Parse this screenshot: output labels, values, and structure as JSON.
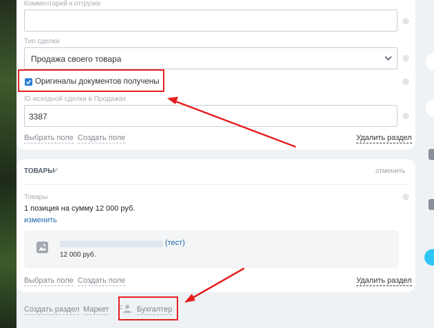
{
  "shipment": {
    "comment_label": "Комментарий к отгрузке",
    "comment_value": ""
  },
  "deal_type": {
    "label": "Тип сделки",
    "value": "Продажа своего товара"
  },
  "originals": {
    "label": "Оригиналы документов получены",
    "checked": true
  },
  "source_deal": {
    "label": "ID исходной сделки в Продажах",
    "value": "3387"
  },
  "section1_footer": {
    "choose_field": "Выбрать поле",
    "create_field": "Создать поле",
    "delete_section": "Удалить раздел"
  },
  "products": {
    "title": "ТОВАРЫ",
    "cancel": "отменить",
    "field_label": "Товары",
    "summary": "1 позиция на сумму 12 000 руб.",
    "change": "изменить",
    "item_suffix": "(тест)",
    "item_price": "12 000 руб."
  },
  "section2_footer": {
    "choose_field": "Выбрать поле",
    "create_field": "Создать поле",
    "delete_section": "Удалить раздел"
  },
  "bottom": {
    "create_section": "Создать раздел",
    "market": "Маркет",
    "accountant": "Бухгалтер"
  },
  "colors": {
    "annotation_red": "#e41e1e",
    "link_blue": "#2067b0",
    "checkbox_blue": "#2d7fd3"
  }
}
